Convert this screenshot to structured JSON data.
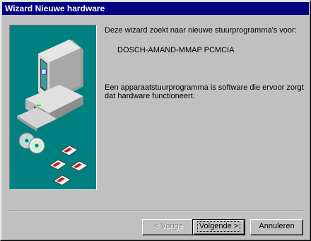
{
  "window": {
    "title": "Wizard Nieuwe hardware"
  },
  "content": {
    "intro": "Deze wizard zoekt naar nieuwe stuurprogramma's voor:",
    "device": "DOSCH-AMAND-MMAP PCMCIA",
    "description": "Een apparaatstuurprogramma is software die ervoor zorgt dat hardware functioneert."
  },
  "buttons": {
    "back": "< Vorige",
    "next": "Volgende >",
    "cancel": "Annuleren"
  },
  "colors": {
    "titlebar": "#000080",
    "illustration_bg": "#008080",
    "face": "#c0c0c0"
  },
  "icons": {
    "illustration": "computer-with-cds-and-floppies"
  }
}
